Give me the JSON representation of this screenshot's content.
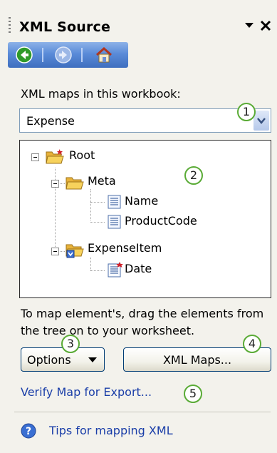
{
  "title": "XML Source",
  "icons": {
    "menu_dropdown": "dropdown-arrow-icon",
    "close": "close-icon",
    "back": "back-arrow-icon",
    "forward": "forward-arrow-icon",
    "home": "home-icon",
    "help": "help-circle-icon"
  },
  "colors": {
    "navbar": "#5a8bd8",
    "link": "#1a3ea8",
    "callout_border": "#5aab36"
  },
  "maps_label": "XML maps in this workbook:",
  "map_select": {
    "value": "Expense"
  },
  "tree": {
    "root": "Root",
    "meta": "Meta",
    "name": "Name",
    "product_code": "ProductCode",
    "expense_item": "ExpenseItem",
    "date": "Date"
  },
  "instructions": "To map element's, drag the elements from the tree on to your worksheet.",
  "buttons": {
    "options": "Options",
    "xml_maps": "XML Maps..."
  },
  "verify_link": "Verify Map for Export...",
  "tips_link": "Tips for mapping XML",
  "callouts": [
    "1",
    "2",
    "3",
    "4",
    "5"
  ]
}
